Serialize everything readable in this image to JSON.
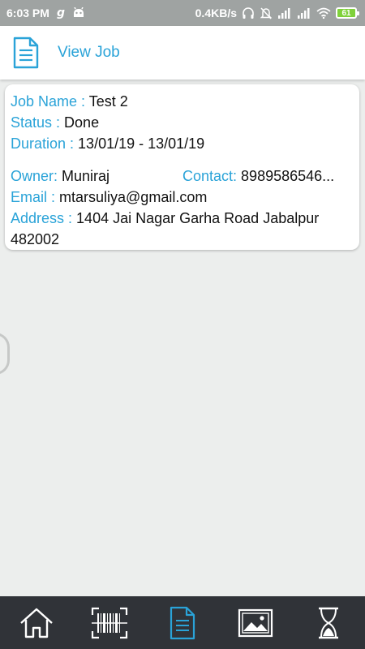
{
  "status_bar": {
    "time": "6:03 PM",
    "network_speed": "0.4KB/s",
    "battery_level": "61",
    "icons": [
      "g-icon",
      "android-icon",
      "headphone-icon",
      "mute-icon",
      "signal-icon",
      "signal-icon",
      "wifi-icon",
      "battery-icon"
    ]
  },
  "app_bar": {
    "title": "View Job",
    "icon": "document-icon"
  },
  "job": {
    "name_label": "Job Name : ",
    "name": "Test 2",
    "status_label": "Status : ",
    "status": "Done",
    "duration_label": "Duration : ",
    "duration": "13/01/19 - 13/01/19",
    "owner_label": "Owner: ",
    "owner": "Muniraj",
    "contact_label": "Contact: ",
    "contact": "8989586546...",
    "email_label": "Email : ",
    "email": "mtarsuliya@gmail.com",
    "address_label": "Address : ",
    "address": "1404 Jai Nagar Garha Road Jabalpur 482002"
  },
  "bottom_nav": {
    "items": [
      "home-icon",
      "barcode-scan-icon",
      "document-icon",
      "gallery-icon",
      "hourglass-icon"
    ],
    "active": "document-icon",
    "colors": {
      "active": "#2aa3d8",
      "inactive": "#ffffff",
      "background": "#303338"
    }
  },
  "colors": {
    "accent": "#2aa3d8",
    "page_background": "#eceeed",
    "status_bar": "#9fa3a2"
  }
}
